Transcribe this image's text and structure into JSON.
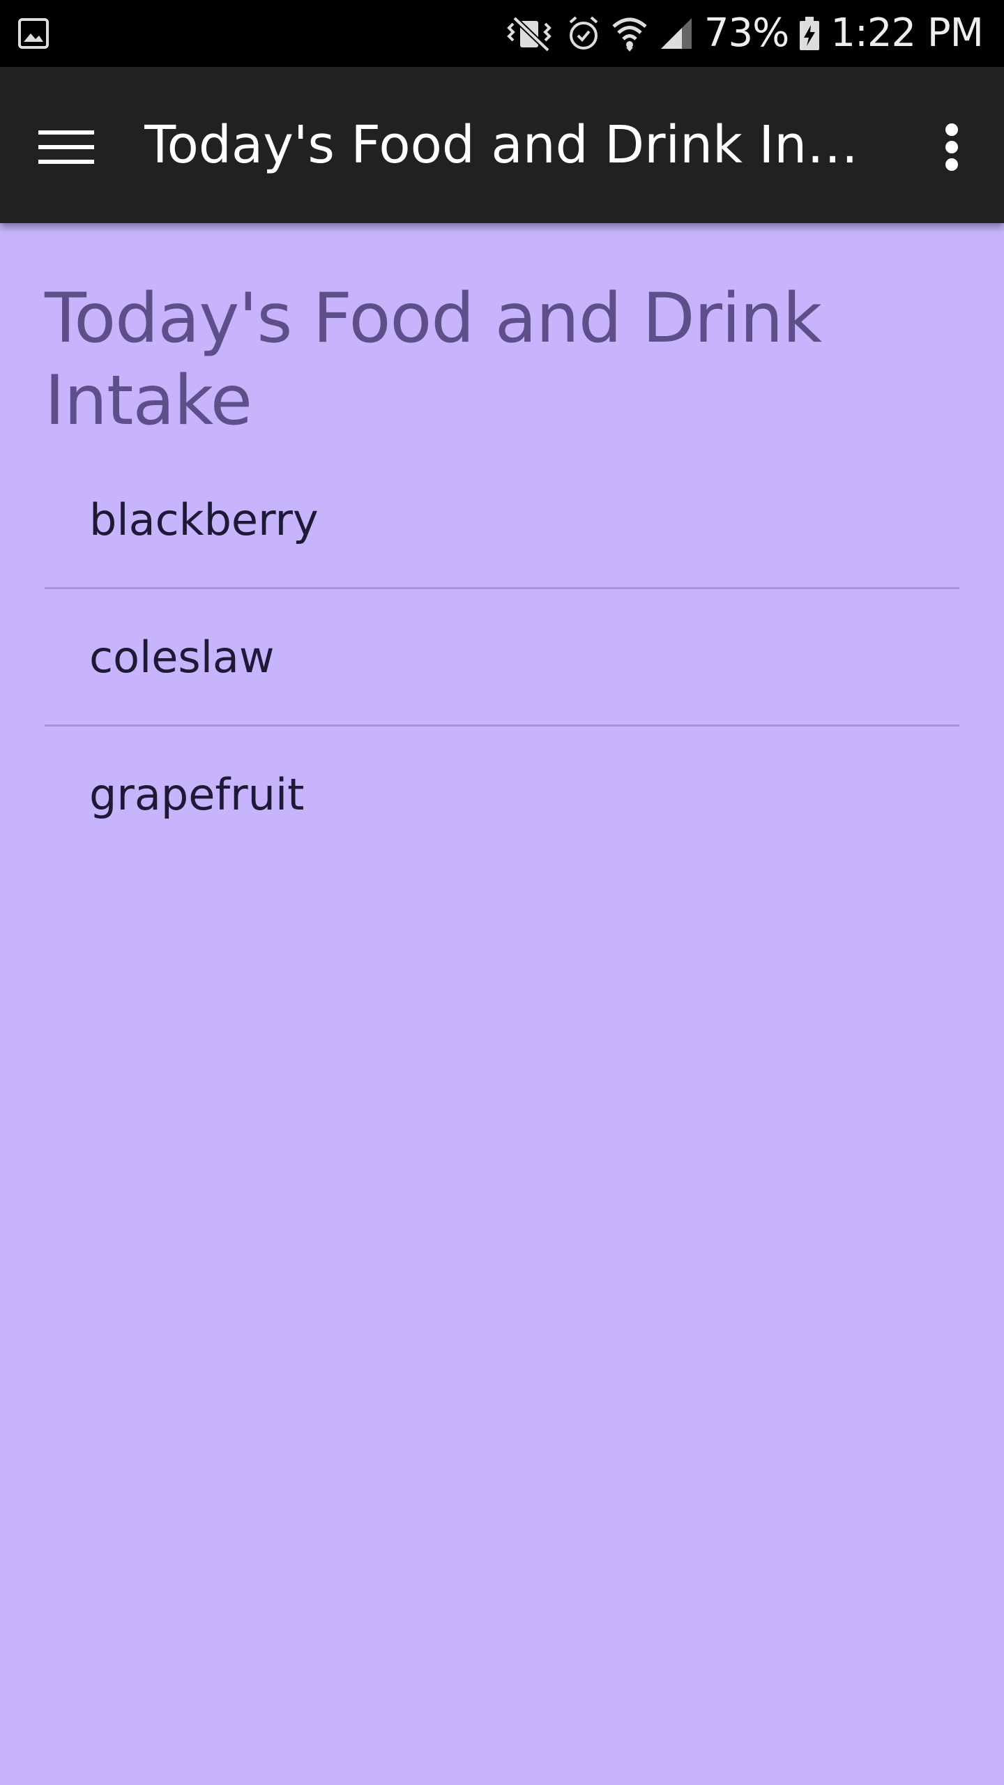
{
  "status_bar": {
    "battery": "73%",
    "time": "1:22 PM",
    "icons": [
      "image-icon",
      "vibrate-icon",
      "alarm-icon",
      "wifi-icon",
      "signal-icon",
      "battery-charging-icon"
    ]
  },
  "app_bar": {
    "title": "Today's Food and Drink Int...",
    "menu_icon": "hamburger-menu-icon",
    "overflow_icon": "more-vert-icon"
  },
  "main": {
    "heading": "Today's Food and Drink Intake",
    "items": [
      {
        "label": "blackberry"
      },
      {
        "label": "coleslaw"
      },
      {
        "label": "grapefruit"
      }
    ]
  },
  "colors": {
    "background": "#c7b4fd",
    "app_bar": "#212121",
    "heading": "#5e4f8b",
    "item_text": "#1d1936",
    "divider": "#a897d8"
  }
}
